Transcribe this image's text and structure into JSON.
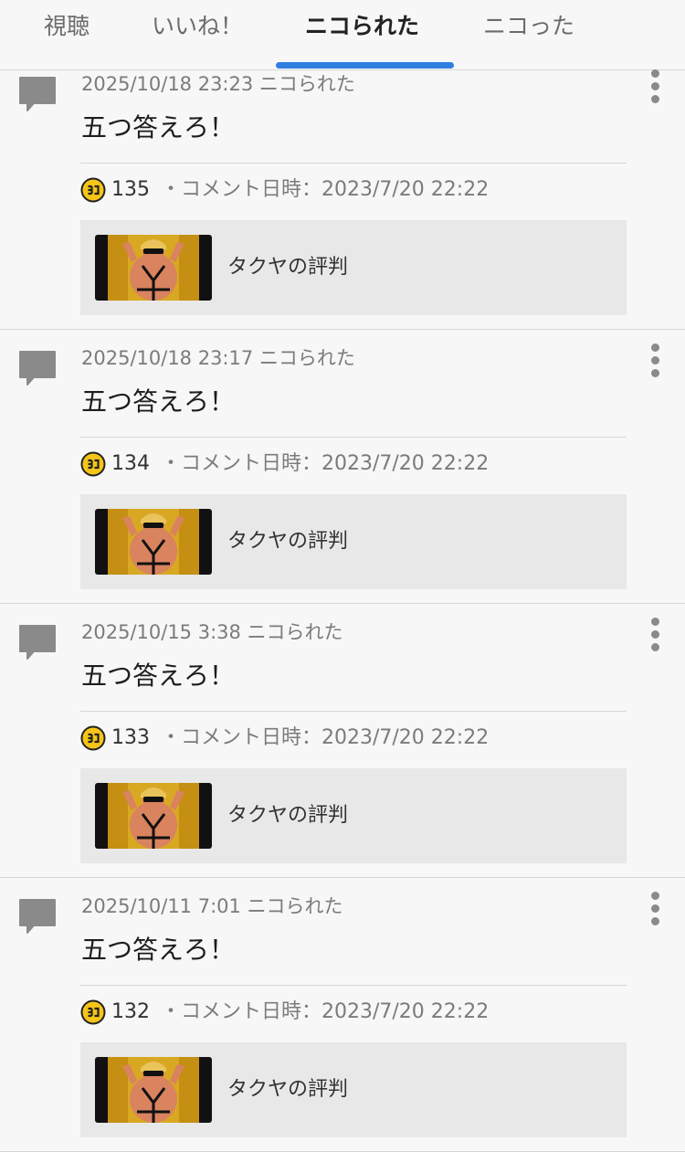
{
  "tabs": [
    {
      "label": "視聴",
      "active": false
    },
    {
      "label": "いいね！",
      "active": false
    },
    {
      "label": "ニコられた",
      "active": true
    },
    {
      "label": "ニコった",
      "active": false
    }
  ],
  "colors": {
    "accent": "#2f7ee0",
    "nico_badge": "#f5c518"
  },
  "items": [
    {
      "timestamp": "2025/10/18 23:23 ニコられた",
      "comment": "五つ答えろ！",
      "count": "135",
      "comment_date": "・コメント日時：2023/7/20 22:22",
      "video_title": "タクヤの評判"
    },
    {
      "timestamp": "2025/10/18 23:17 ニコられた",
      "comment": "五つ答えろ！",
      "count": "134",
      "comment_date": "・コメント日時：2023/7/20 22:22",
      "video_title": "タクヤの評判"
    },
    {
      "timestamp": "2025/10/15 3:38 ニコられた",
      "comment": "五つ答えろ！",
      "count": "133",
      "comment_date": "・コメント日時：2023/7/20 22:22",
      "video_title": "タクヤの評判"
    },
    {
      "timestamp": "2025/10/11 7:01 ニコられた",
      "comment": "五つ答えろ！",
      "count": "132",
      "comment_date": "・コメント日時：2023/7/20 22:22",
      "video_title": "タクヤの評判"
    }
  ]
}
